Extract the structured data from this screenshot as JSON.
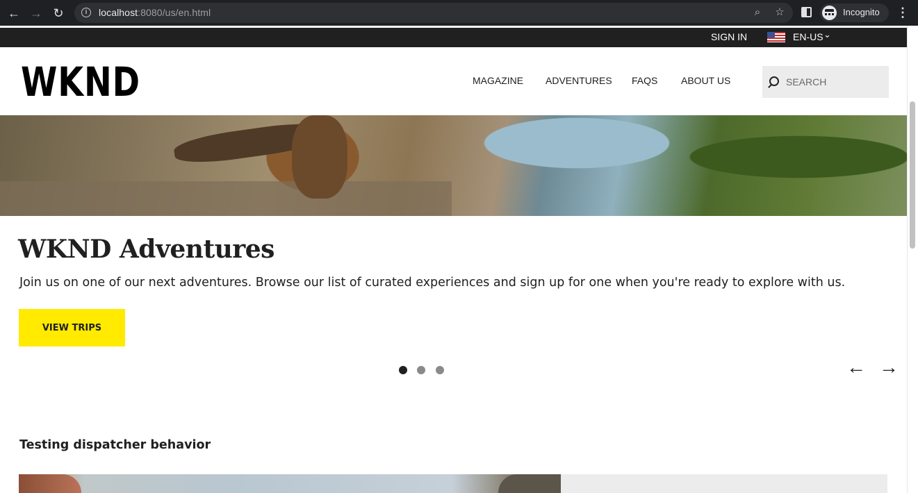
{
  "browser": {
    "url_host": "localhost",
    "url_rest": ":8080/us/en.html",
    "profile_label": "Incognito"
  },
  "topbar": {
    "signin_label": "SIGN IN",
    "language_label": "EN-US"
  },
  "header": {
    "logo_text": "WKND",
    "nav": [
      "MAGAZINE",
      "ADVENTURES",
      "FAQS",
      "ABOUT US"
    ],
    "search_placeholder": "SEARCH"
  },
  "hero": {
    "title": "WKND Adventures",
    "description": "Join us on one of our next adventures. Browse our list of curated experiences and sign up for one when you're ready to explore with us.",
    "cta_label": "VIEW TRIPS",
    "slide_count": 3,
    "active_slide": 1
  },
  "section": {
    "title": "Testing dispatcher behavior"
  },
  "colors": {
    "accent_yellow": "#ffea00",
    "topbar_dark": "#202020",
    "search_bg": "#ececec"
  },
  "icons": {
    "back": "arrow-left-icon",
    "forward": "arrow-right-icon",
    "reload": "reload-icon",
    "site_info": "info-icon",
    "zoom": "zoom-icon",
    "bookmark": "star-icon",
    "side_panel": "side-panel-icon",
    "incognito": "incognito-icon",
    "menu": "more-vert-icon",
    "flag": "us-flag-icon",
    "lang_chevron": "chevron-down-icon",
    "search": "search-icon",
    "carousel_prev": "arrow-left-icon",
    "carousel_next": "arrow-right-icon"
  }
}
